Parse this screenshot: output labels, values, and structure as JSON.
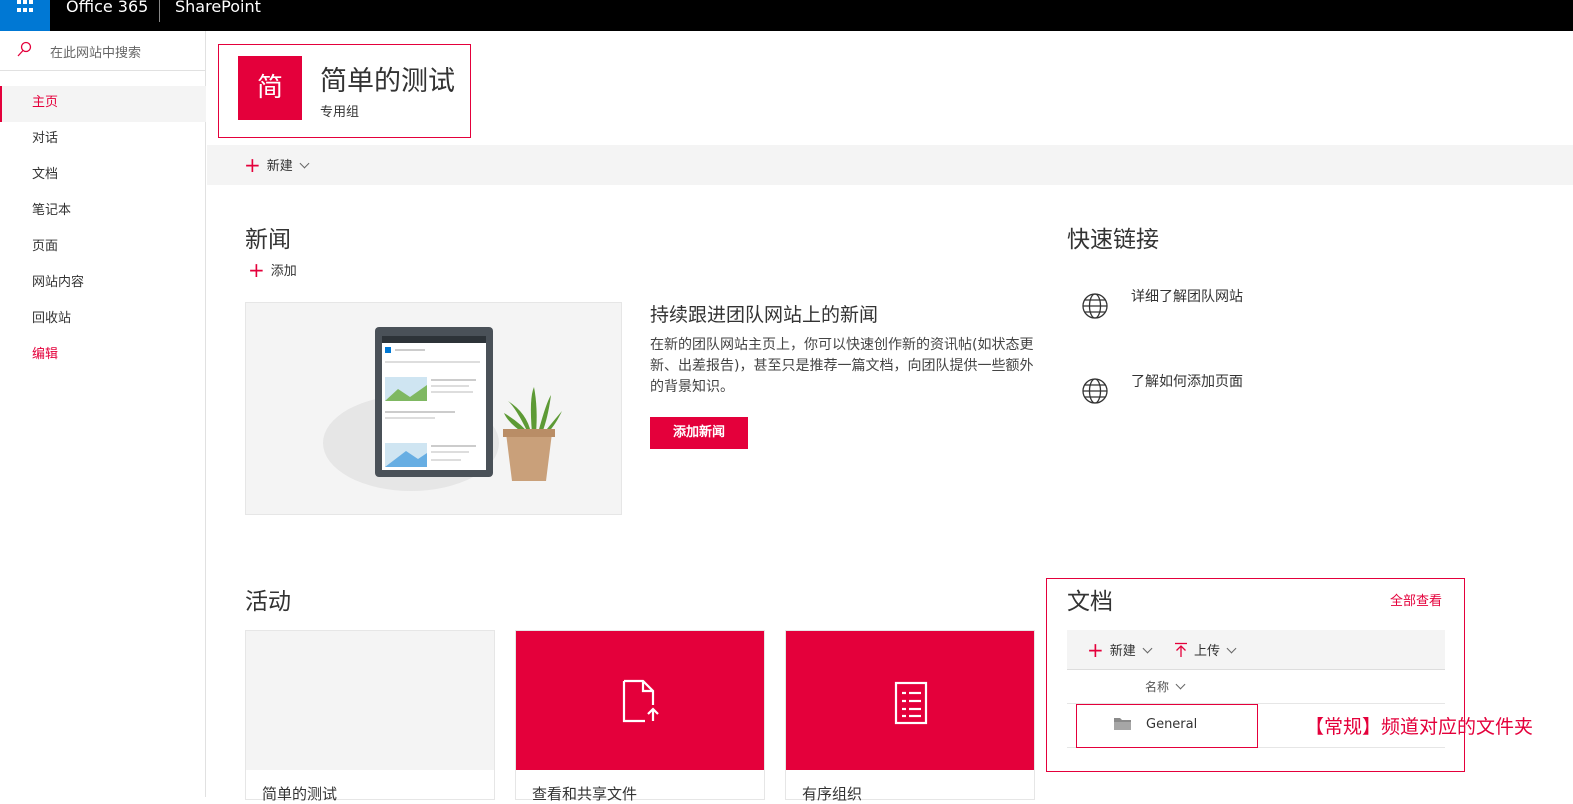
{
  "topbar": {
    "brand": "Office 365",
    "app": "SharePoint"
  },
  "search": {
    "placeholder": "在此网站中搜索"
  },
  "nav": [
    {
      "label": "主页",
      "state": "active"
    },
    {
      "label": "对话"
    },
    {
      "label": "文档"
    },
    {
      "label": "笔记本"
    },
    {
      "label": "页面"
    },
    {
      "label": "网站内容"
    },
    {
      "label": "回收站"
    },
    {
      "label": "编辑",
      "state": "edit"
    }
  ],
  "site": {
    "logo_char": "简",
    "title": "简单的测试",
    "subtitle": "专用组"
  },
  "command": {
    "new_label": "新建"
  },
  "news": {
    "heading": "新闻",
    "add_label": "添加",
    "title": "持续跟进团队网站上的新闻",
    "description": "在新的团队网站主页上，你可以快速创作新的资讯帖(如状态更新、出差报告)，甚至只是推荐一篇文档，向团队提供一些额外的背景知识。",
    "button": "添加新闻"
  },
  "quicklinks": {
    "heading": "快速链接",
    "items": [
      "详细了解团队网站",
      "了解如何添加页面"
    ]
  },
  "activity": {
    "heading": "活动",
    "cards": [
      "简单的测试",
      "查看和共享文件",
      "有序组织"
    ]
  },
  "documents": {
    "heading": "文档",
    "view_all": "全部查看",
    "new_label": "新建",
    "upload_label": "上传",
    "column_name": "名称",
    "folder": "General",
    "annotation": "【常规】频道对应的文件夹"
  },
  "colors": {
    "accent": "#e4003b",
    "waffle": "#0078d4"
  }
}
